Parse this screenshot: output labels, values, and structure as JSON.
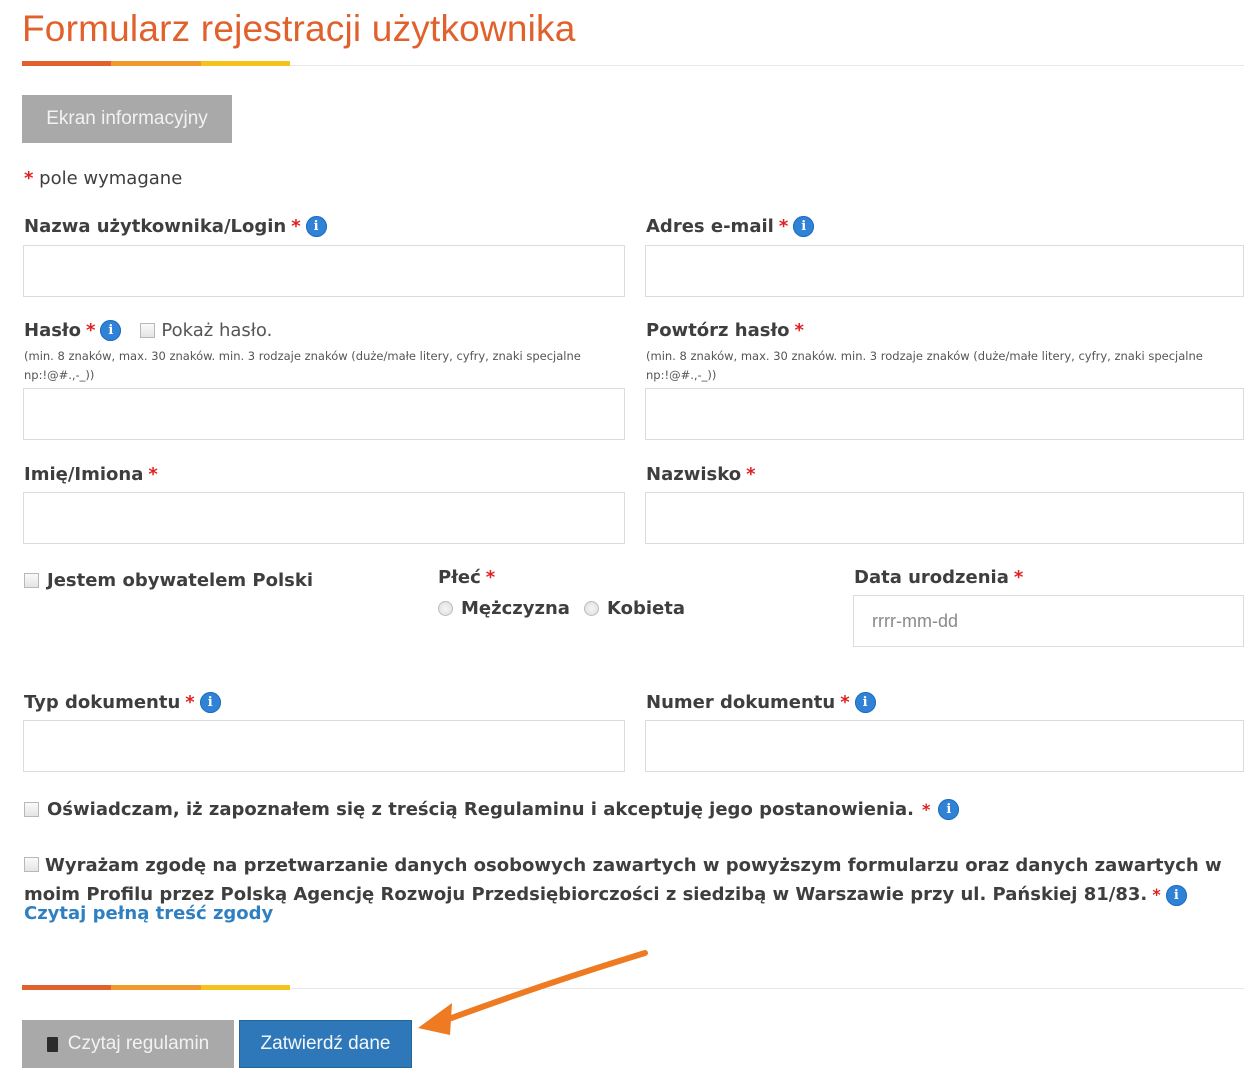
{
  "page": {
    "title": "Formularz rejestracji użytkownika",
    "info_screen_button": "Ekran informacyjny",
    "required_note": "pole wymagane"
  },
  "fields": {
    "login": {
      "label": "Nazwa użytkownika/Login",
      "value": ""
    },
    "email": {
      "label": "Adres e-mail",
      "value": ""
    },
    "password": {
      "label": "Hasło",
      "show_password": "Pokaż hasło.",
      "hint": "(min. 8 znaków, max. 30 znaków. min. 3 rodzaje znaków (duże/małe litery, cyfry, znaki specjalne np:!@#.,-_))",
      "value": ""
    },
    "password_repeat": {
      "label": "Powtórz hasło",
      "hint": "(min. 8 znaków, max. 30 znaków. min. 3 rodzaje znaków (duże/małe litery, cyfry, znaki specjalne np:!@#.,-_))",
      "value": ""
    },
    "first_name": {
      "label": "Imię/Imiona",
      "value": ""
    },
    "last_name": {
      "label": "Nazwisko",
      "value": ""
    },
    "citizen": {
      "label": "Jestem obywatelem Polski"
    },
    "gender": {
      "label": "Płeć",
      "male": "Mężczyzna",
      "female": "Kobieta"
    },
    "birth_date": {
      "label": "Data urodzenia",
      "placeholder": "rrrr-mm-dd"
    },
    "doc_type": {
      "label": "Typ dokumentu",
      "value": ""
    },
    "doc_number": {
      "label": "Numer dokumentu",
      "value": ""
    }
  },
  "consents": {
    "terms": "Oświadczam, iż zapoznałem się z treścią Regulaminu i akceptuję jego postanowienia.",
    "data_processing": "Wyrażam zgodę na przetwarzanie danych osobowych zawartych w powyższym formularzu oraz danych zawartych w moim Profilu przez Polską Agencję Rozwoju Przedsiębiorczości z siedzibą w Warszawie przy ul. Pańskiej 81/83.",
    "read_full_link": "Czytaj pełną treść zgody"
  },
  "actions": {
    "read_terms": "Czytaj regulamin",
    "submit": "Zatwierdź dane"
  },
  "common": {
    "required_mark": "*",
    "info_mark": "i"
  },
  "colors": {
    "title": "#e0612b",
    "accent": [
      "#e0612b",
      "#f09a2e",
      "#f5c21b"
    ],
    "primary_button": "#2e78b9",
    "secondary_button": "#a9a9a9",
    "required": "#e02020",
    "info_icon": "#2f82d6",
    "link": "#2f7fc1",
    "annotation_arrow": "#ee7a22"
  }
}
